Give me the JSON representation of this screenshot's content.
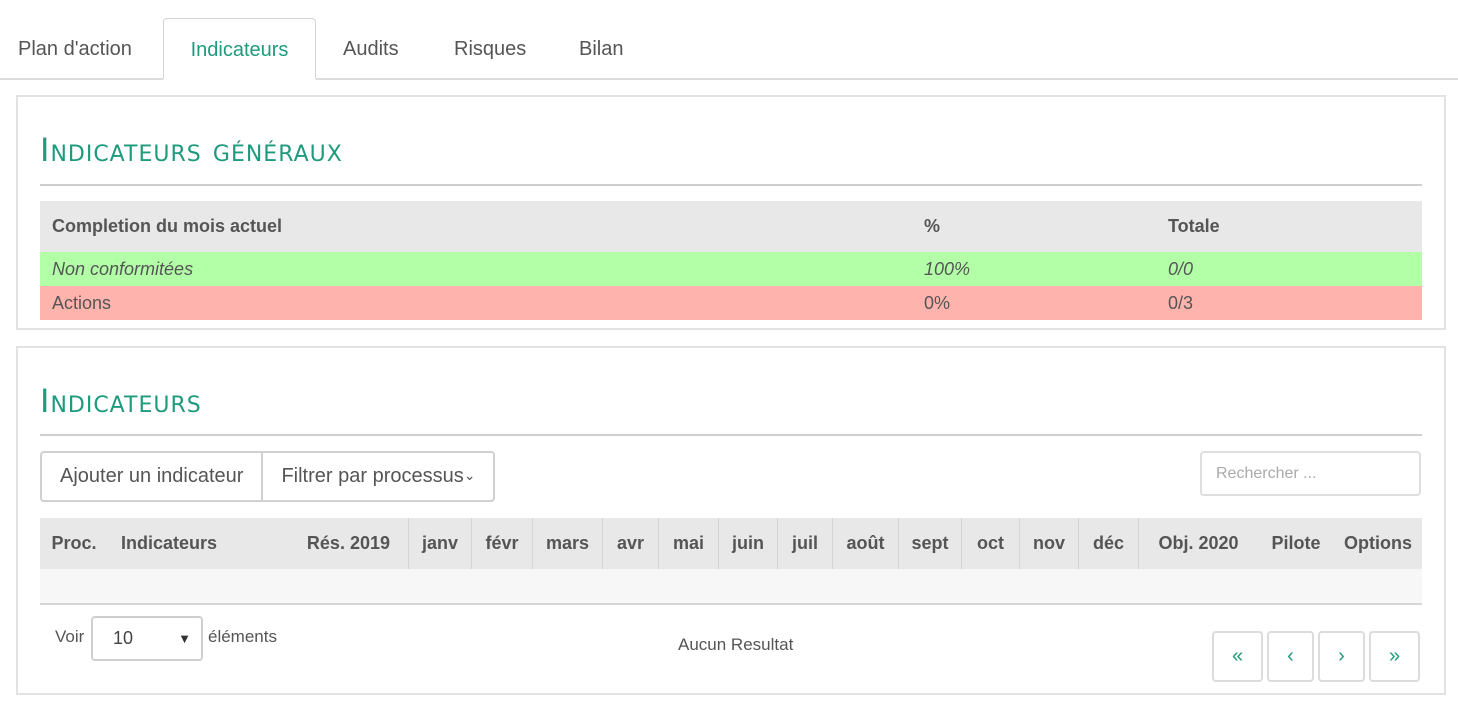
{
  "tabs": [
    {
      "label": "Plan d'action"
    },
    {
      "label": "Indicateurs"
    },
    {
      "label": "Audits"
    },
    {
      "label": "Risques"
    },
    {
      "label": "Bilan"
    }
  ],
  "active_tab": "Indicateurs",
  "general": {
    "title": "Indicateurs généraux",
    "header": {
      "label": "Completion du mois actuel",
      "percent": "%",
      "total": "Totale"
    },
    "rows": [
      {
        "label": "Non conformitées",
        "percent": "100%",
        "total": "0/0",
        "status_color": "#b3ffa8"
      },
      {
        "label": "Actions",
        "percent": "0%",
        "total": "0/3",
        "status_color": "#ffb3ad"
      }
    ]
  },
  "indicators": {
    "title": "Indicateurs",
    "add_button": "Ajouter un indicateur",
    "filter_button": "Filtrer par processus",
    "search_placeholder": "Rechercher ...",
    "columns": [
      "Proc.",
      "Indicateurs",
      "Rés. 2019",
      "janv",
      "févr",
      "mars",
      "avr",
      "mai",
      "juin",
      "juil",
      "août",
      "sept",
      "oct",
      "nov",
      "déc",
      "Obj. 2020",
      "Pilote",
      "Options"
    ],
    "page_size_label_before": "Voir",
    "page_size_value": "10",
    "page_size_label_after": "éléments",
    "empty_message": "Aucun Resultat",
    "pagination": [
      "«",
      "‹",
      "›",
      "»"
    ]
  },
  "colors": {
    "accent": "#1f9a7d",
    "ok_row": "#b3ffa8",
    "bad_row": "#ffb3ad"
  }
}
